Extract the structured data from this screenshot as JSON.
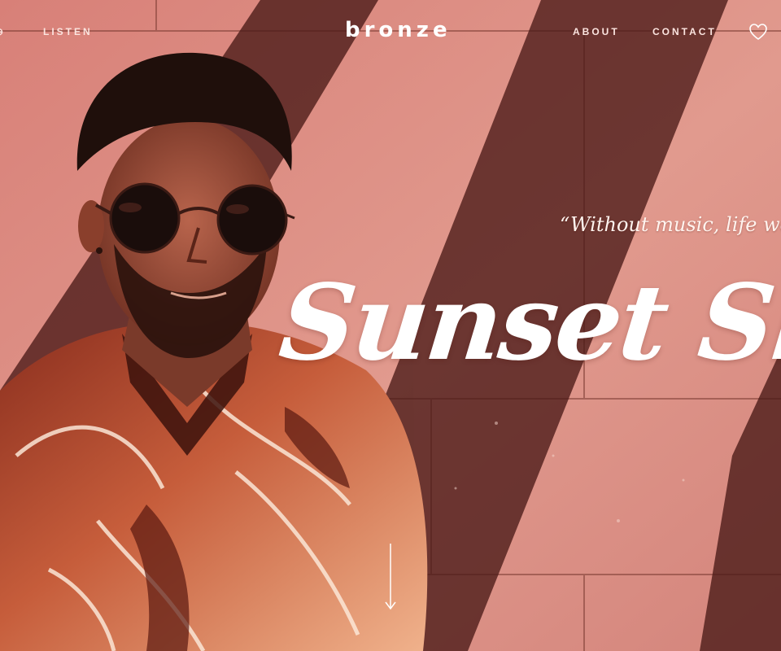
{
  "nav": {
    "partial_item": "⊕",
    "listen": "LISTEN",
    "logo": "bronze",
    "about": "ABOUT",
    "contact": "CONTACT"
  },
  "hero": {
    "quote": "“Without music, life would",
    "title": "Sunset Sk"
  },
  "colors": {
    "wall": "#d9877e",
    "shadow": "#5a2420",
    "text": "#ffffff"
  },
  "icons": {
    "favorite": "heart-icon",
    "scroll": "arrow-down-icon"
  }
}
